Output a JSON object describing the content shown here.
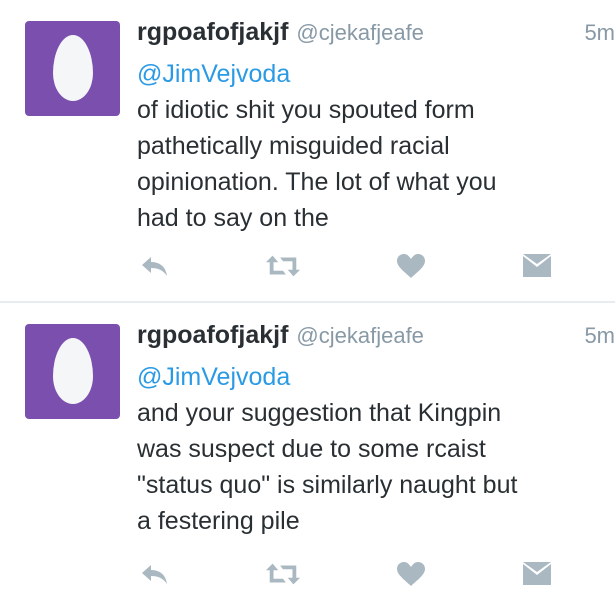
{
  "colors": {
    "avatar_bg": "#7a4fae",
    "egg": "#f4f6f8",
    "mention": "#2b9ae5",
    "text": "#292f33",
    "muted": "#8899a6",
    "icon": "#aab8c2",
    "divider": "#e6ecf0"
  },
  "tweets": [
    {
      "display_name": "rgpoafofjakjf",
      "screen_name": "@cjekafjeafe",
      "timestamp": "5m",
      "mention": "@JimVejvoda",
      "lines": [
        "of idiotic shit you spouted form",
        "pathetically misguided racial",
        "opinionation. The lot of what you",
        "had to say on the"
      ],
      "icons": [
        "reply-icon",
        "retweet-icon",
        "like-icon",
        "direct-message-icon"
      ]
    },
    {
      "display_name": "rgpoafofjakjf",
      "screen_name": "@cjekafjeafe",
      "timestamp": "5m",
      "mention": "@JimVejvoda",
      "lines": [
        "and your suggestion that Kingpin",
        "was suspect due to some rcaist",
        "\"status quo\" is similarly naught but",
        "a festering pile"
      ],
      "icons": [
        "reply-icon",
        "retweet-icon",
        "like-icon",
        "direct-message-icon"
      ]
    }
  ]
}
